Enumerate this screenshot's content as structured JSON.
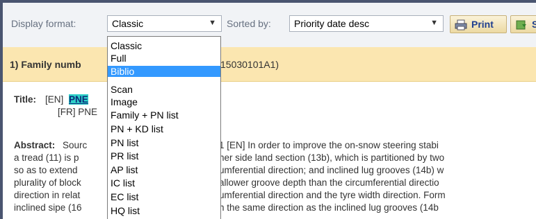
{
  "toolbar": {
    "display_format_label": "Display format:",
    "display_format_value": "Classic",
    "sorted_by_label": "Sorted by:",
    "sorted_by_value": "Priority date desc",
    "print_label": "Print",
    "second_button_label": "S"
  },
  "result": {
    "heading": "1) Family numb",
    "heading_tail": "15030101A1)"
  },
  "record": {
    "title_label": "Title:",
    "title_en_lang": "[EN]",
    "title_en_highlight": "PNE",
    "title_fr_lang": "[FR] PNE",
    "abstract_label": "Abstract:",
    "abstract_head": "Sourc",
    "abstract_lines_left": [
      "a tread (11) is p",
      "so as to extend",
      "plurality of block",
      "direction in relat",
      "inclined sipe (16"
    ],
    "abstract_lines_right": [
      "1 [EN] In order to improve the on-snow steering stabi",
      "her side land section (13b), which is partitioned by two",
      "umferential direction; and inclined lug grooves (14b) w",
      "allower groove depth than the circumferential directio",
      "umferential direction and the tyre width direction. Form",
      "n the same direction as the inclined lug grooves (14b"
    ]
  },
  "dropdown": {
    "options": [
      {
        "label": "Classic"
      },
      {
        "label": "Full"
      },
      {
        "label": "Biblio",
        "selected": true
      },
      {
        "label": "Scan"
      },
      {
        "label": "Image"
      },
      {
        "label": "Family + PN list"
      },
      {
        "label": "PN + KD list"
      },
      {
        "label": "PN list"
      },
      {
        "label": "PR list"
      },
      {
        "label": "AP list"
      },
      {
        "label": "IC list"
      },
      {
        "label": "EC list"
      },
      {
        "label": "HQ list"
      }
    ]
  },
  "colors": {
    "selection": "#3399ff",
    "result_bar": "#fbe6b0",
    "highlight": "#2fd0c8",
    "link_blue": "#1f3f8f"
  },
  "icons": [
    "chevron-down-icon",
    "printer-icon",
    "save-icon"
  ]
}
